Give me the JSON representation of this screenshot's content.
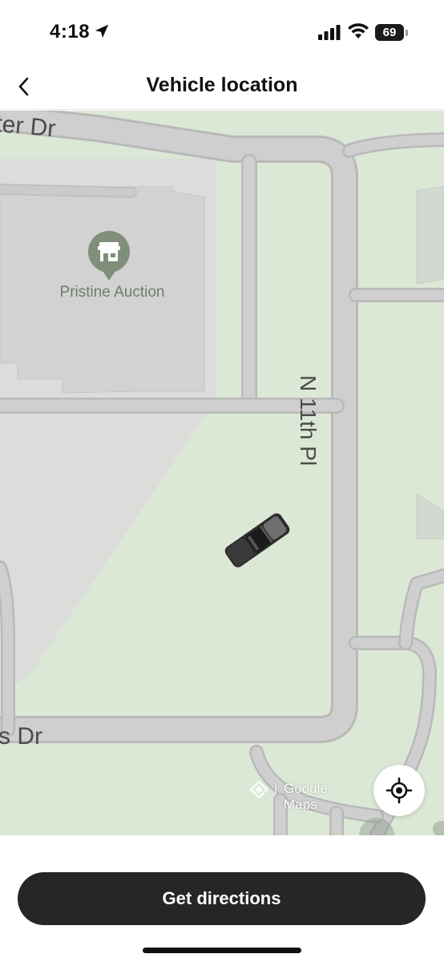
{
  "status_bar": {
    "time": "4:18",
    "battery": "69",
    "icons": [
      "location-arrow-icon",
      "signal-icon",
      "wifi-icon",
      "battery-icon"
    ]
  },
  "header": {
    "title": "Vehicle location",
    "back_icon": "chevron-left-icon"
  },
  "map": {
    "streets": {
      "top": "ter Dr",
      "bottom": "s Dr",
      "right": "N 11th Pl"
    },
    "poi": {
      "label": "Pristine Auction",
      "icon": "store-icon"
    },
    "vehicle_icon": "car-icon",
    "attribution": "Google Maps",
    "recenter_icon": "crosshair-icon",
    "colors": {
      "land": "#dbe8d6",
      "road": "#cfcfcf",
      "road_edge": "#b9b9b9",
      "building": "#d2d2d2",
      "poi_pin": "#7f8f79"
    }
  },
  "actions": {
    "get_directions": "Get directions"
  }
}
